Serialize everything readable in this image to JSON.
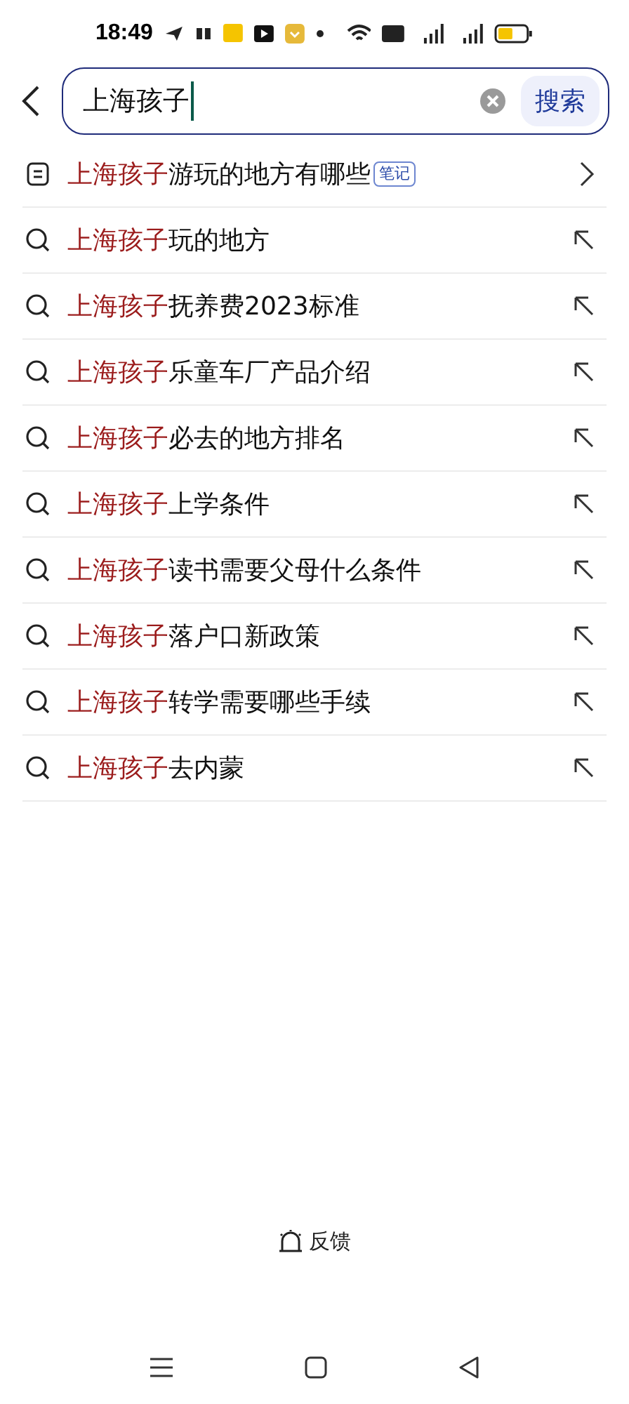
{
  "status_bar": {
    "time": "18:49"
  },
  "search": {
    "value": "上海孩子",
    "button": "搜索"
  },
  "suggestions": [
    {
      "kind": "note",
      "match": "上海孩子",
      "rest": "游玩的地方有哪些",
      "tag": "笔记"
    },
    {
      "kind": "query",
      "match": "上海孩子",
      "rest": "玩的地方"
    },
    {
      "kind": "query",
      "match": "上海孩子",
      "rest": "抚养费2023标准"
    },
    {
      "kind": "query",
      "match": "上海孩子",
      "rest": "乐童车厂产品介绍"
    },
    {
      "kind": "query",
      "match": "上海孩子",
      "rest": "必去的地方排名"
    },
    {
      "kind": "query",
      "match": "上海孩子",
      "rest": "上学条件"
    },
    {
      "kind": "query",
      "match": "上海孩子",
      "rest": "读书需要父母什么条件"
    },
    {
      "kind": "query",
      "match": "上海孩子",
      "rest": "落户口新政策"
    },
    {
      "kind": "query",
      "match": "上海孩子",
      "rest": "转学需要哪些手续"
    },
    {
      "kind": "query",
      "match": "上海孩子",
      "rest": "去内蒙"
    }
  ],
  "feedback": "反馈"
}
